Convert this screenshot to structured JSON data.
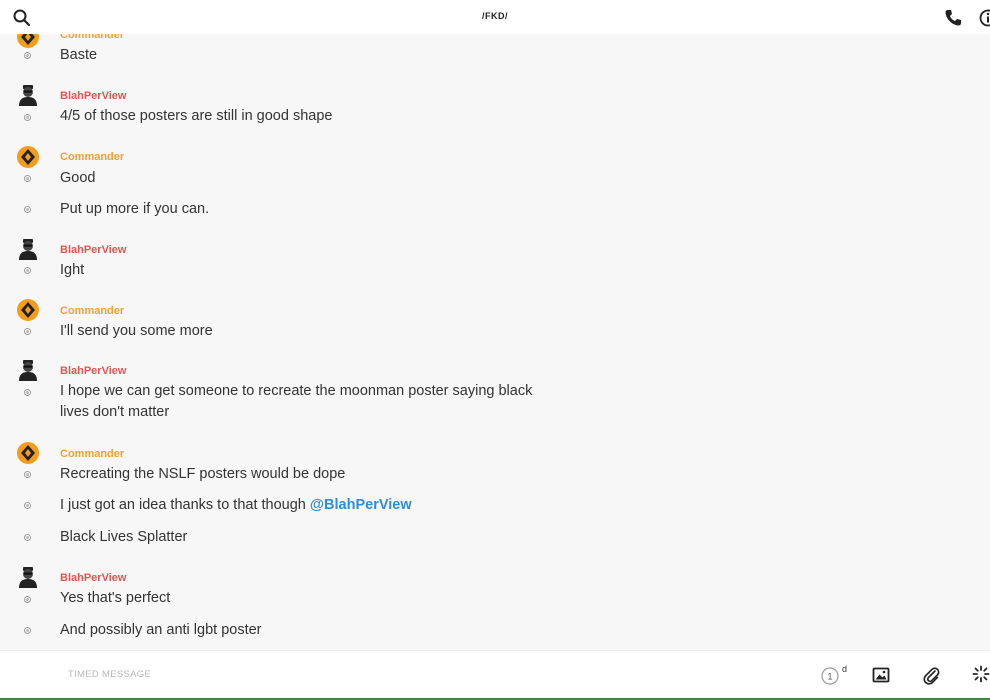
{
  "header": {
    "title": "/FKD/"
  },
  "colors": {
    "commander": "#f0a030",
    "blahperview": "#e0554f",
    "mention": "#2e8dd6",
    "bottom_accent": "#3a8a3a"
  },
  "icons": [
    "search-icon",
    "phone-icon",
    "info-icon",
    "timer-icon",
    "image-icon",
    "paperclip-icon",
    "sparkle-icon"
  ],
  "messages": [
    {
      "author": "Commander",
      "text": "Baste"
    },
    {
      "author": "BlahPerView",
      "text": "4/5 of those posters are still in good shape"
    },
    {
      "author": "Commander",
      "text": "Good"
    },
    {
      "author": "",
      "text": "Put up more if you can."
    },
    {
      "author": "BlahPerView",
      "text": "Ight"
    },
    {
      "author": "Commander",
      "text": "I'll send you some more"
    },
    {
      "author": "BlahPerView",
      "text": "I hope we can get someone to recreate the moonman poster saying black lives don't matter"
    },
    {
      "author": "Commander",
      "text": "Recreating the NSLF posters would be dope"
    },
    {
      "author": "",
      "text": "I just got an idea thanks to that though ",
      "mention": "@BlahPerView"
    },
    {
      "author": "",
      "text": "Black Lives Splatter"
    },
    {
      "author": "BlahPerView",
      "text": "Yes that's perfect"
    },
    {
      "author": "",
      "text": "And possibly an anti lgbt poster"
    }
  ],
  "composer": {
    "placeholder": "TIMED MESSAGE",
    "timer_value": "1",
    "timer_unit": "d"
  }
}
